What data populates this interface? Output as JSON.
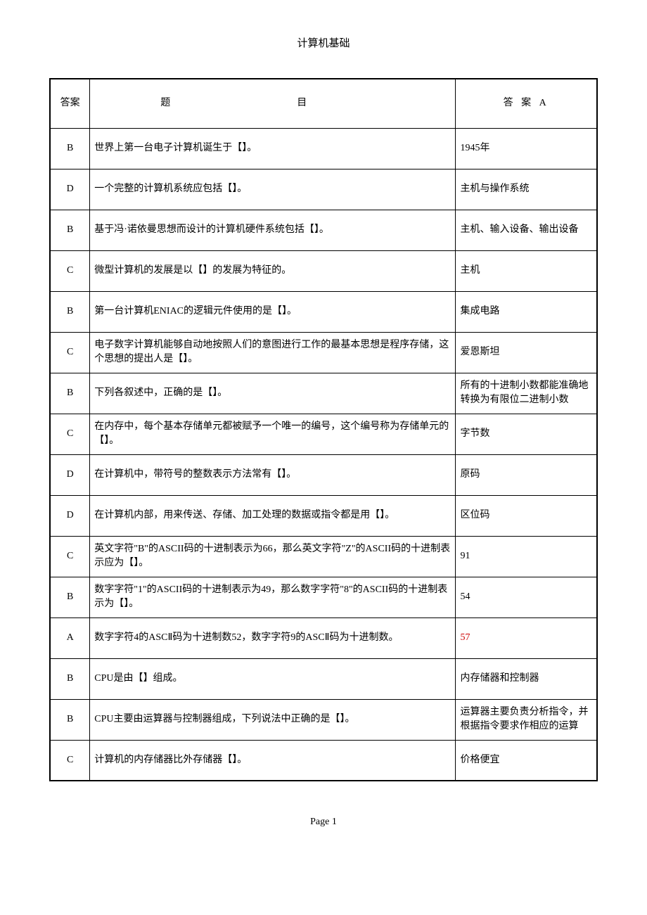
{
  "header": {
    "title": "计算机基础"
  },
  "table": {
    "headers": {
      "answer": "答案",
      "question": "题目",
      "choice": "答 案 A"
    },
    "rows": [
      {
        "answer": "B",
        "question": "世界上第一台电子计算机诞生于【】。",
        "choice": "1945年",
        "red": false
      },
      {
        "answer": "D",
        "question": "一个完整的计算机系统应包括【】。",
        "choice": "主机与操作系统",
        "red": false
      },
      {
        "answer": "B",
        "question": "基于冯·诺依曼思想而设计的计算机硬件系统包括【】。",
        "choice": "主机、输入设备、输出设备",
        "red": false
      },
      {
        "answer": "C",
        "question": "微型计算机的发展是以【】的发展为特征的。",
        "choice": "主机",
        "red": false
      },
      {
        "answer": "B",
        "question": "第一台计算机ENIAC的逻辑元件使用的是【】。",
        "choice": "集成电路",
        "red": false
      },
      {
        "answer": "C",
        "question": "电子数字计算机能够自动地按照人们的意图进行工作的最基本思想是程序存储，这个思想的提出人是【】。",
        "choice": "爱恩斯坦",
        "red": false
      },
      {
        "answer": "B",
        "question": "下列各叙述中，正确的是【】。",
        "choice": "所有的十进制小数都能准确地转换为有限位二进制小数",
        "red": false
      },
      {
        "answer": "C",
        "question": "在内存中，每个基本存储单元都被赋予一个唯一的编号，这个编号称为存储单元的【】。",
        "choice": "字节数",
        "red": false
      },
      {
        "answer": "D",
        "question": "在计算机中，带符号的整数表示方法常有【】。",
        "choice": "原码",
        "red": false
      },
      {
        "answer": "D",
        "question": "在计算机内部，用来传送、存储、加工处理的数据或指令都是用【】。",
        "choice": "区位码",
        "red": false
      },
      {
        "answer": "C",
        "question": "英文字符\"B\"的ASCII码的十进制表示为66，那么英文字符\"Z\"的ASCII码的十进制表示应为【】。",
        "choice": "91",
        "red": false
      },
      {
        "answer": "B",
        "question": "数字字符\"1\"的ASCII码的十进制表示为49，那么数字字符\"8\"的ASCII码的十进制表示为【】。",
        "choice": "54",
        "red": false
      },
      {
        "answer": "A",
        "question": "数字字符4的ASCⅡ码为十进制数52，数字字符9的ASCⅡ码为十进制数。",
        "choice": "57",
        "red": true
      },
      {
        "answer": "B",
        "question": "CPU是由【】组成。",
        "choice": "内存储器和控制器",
        "red": false
      },
      {
        "answer": "B",
        "question": "CPU主要由运算器与控制器组成，下列说法中正确的是【】。",
        "choice": "运算器主要负责分析指令，并根据指令要求作相应的运算",
        "red": false
      },
      {
        "answer": "C",
        "question": "计算机的内存储器比外存储器【】。",
        "choice": "价格便宜",
        "red": false
      }
    ]
  },
  "footer": {
    "page_label": "Page 1"
  }
}
